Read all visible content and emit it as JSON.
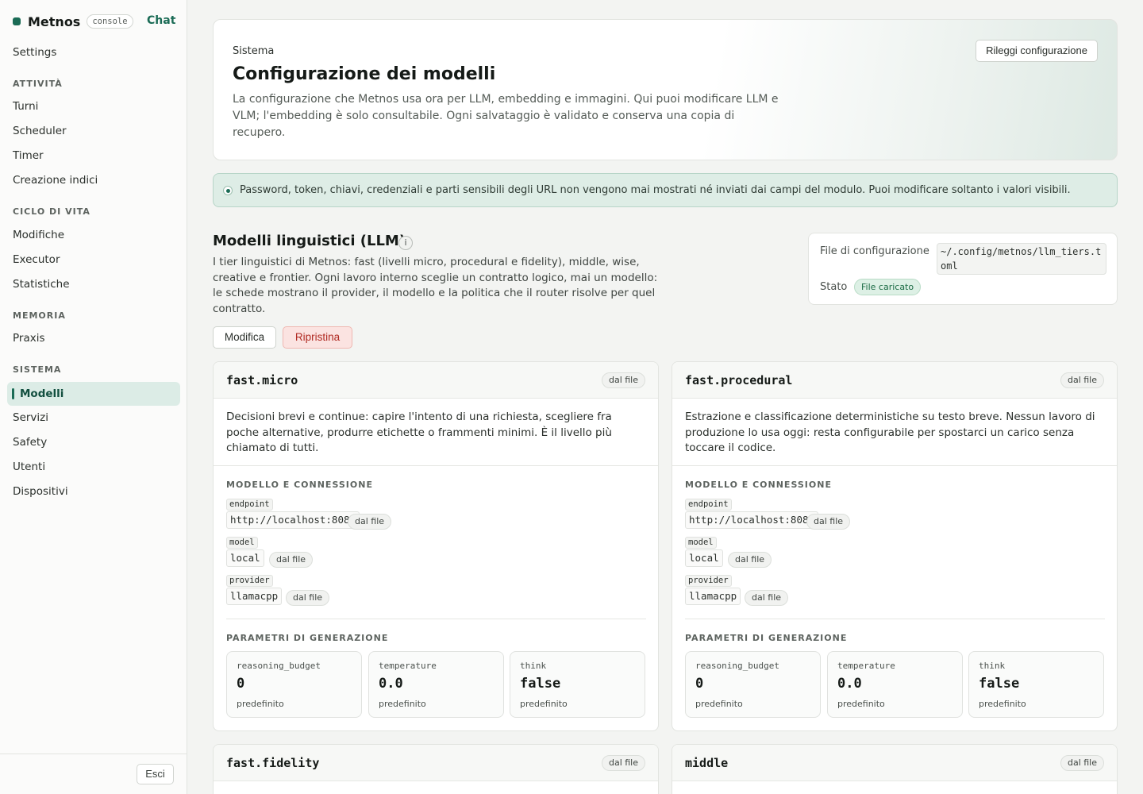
{
  "sidebar": {
    "brand": "Metnos",
    "badge": "console",
    "chat": "Chat",
    "settings": "Settings",
    "sections": [
      {
        "title": "ATTIVITÀ",
        "items": [
          "Turni",
          "Scheduler",
          "Timer",
          "Creazione indici"
        ]
      },
      {
        "title": "CICLO DI VITA",
        "items": [
          "Modifiche",
          "Executor",
          "Statistiche"
        ]
      },
      {
        "title": "MEMORIA",
        "items": [
          "Praxis"
        ]
      },
      {
        "title": "SISTEMA",
        "items": [
          "Modelli",
          "Servizi",
          "Safety",
          "Utenti",
          "Dispositivi"
        ]
      }
    ],
    "active": "Modelli",
    "logout": "Esci"
  },
  "header": {
    "kicker": "Sistema",
    "title": "Configurazione dei modelli",
    "description": "La configurazione che Metnos usa ora per LLM, embedding e immagini. Qui puoi modificare LLM e VLM; l'embedding è solo consultabile. Ogni salvataggio è validato e conserva una copia di recupero.",
    "reload_button": "Rileggi configurazione"
  },
  "notice": "Password, token, chiavi, credenziali e parti sensibili degli URL non vengono mai mostrati né inviati dai campi del modulo. Puoi modificare soltanto i valori visibili.",
  "llm": {
    "title": "Modelli linguistici (LLM)",
    "info": "i",
    "description": "I tier linguistici di Metnos: fast (livelli micro, procedural e fidelity), middle, wise, creative e frontier. Ogni lavoro interno sceglie un contratto logico, mai un modello: le schede mostrano il provider, il modello e la politica che il router risolve per quel contratto.",
    "edit_button": "Modifica",
    "reset_button": "Ripristina",
    "config": {
      "file_label": "File di configurazione",
      "file_path": "~/.config/metnos/llm_tiers.toml",
      "state_label": "Stato",
      "state_value": "File caricato"
    }
  },
  "labels": {
    "model_section": "MODELLO E CONNESSIONE",
    "params_section": "PARAMETRI DI GENERAZIONE"
  },
  "cards": [
    {
      "name": "fast.micro",
      "source": "dal file",
      "description": "Decisioni brevi e continue: capire l'intento di una richiesta, scegliere fra poche alternative, produrre etichette o frammenti minimi. È il livello più chiamato di tutti.",
      "fields": [
        {
          "label": "endpoint",
          "value": "http://localhost:8080",
          "source": "dal file"
        },
        {
          "label": "model",
          "value": "local",
          "source": "dal file"
        },
        {
          "label": "provider",
          "value": "llamacpp",
          "source": "dal file"
        }
      ],
      "params": [
        {
          "name": "reasoning_budget",
          "value": "0",
          "note": "predefinito"
        },
        {
          "name": "temperature",
          "value": "0.0",
          "note": "predefinito"
        },
        {
          "name": "think",
          "value": "false",
          "note": "predefinito"
        }
      ]
    },
    {
      "name": "fast.procedural",
      "source": "dal file",
      "description": "Estrazione e classificazione deterministiche su testo breve. Nessun lavoro di produzione lo usa oggi: resta configurabile per spostarci un carico senza toccare il codice.",
      "fields": [
        {
          "label": "endpoint",
          "value": "http://localhost:8080",
          "source": "dal file"
        },
        {
          "label": "model",
          "value": "local",
          "source": "dal file"
        },
        {
          "label": "provider",
          "value": "llamacpp",
          "source": "dal file"
        }
      ],
      "params": [
        {
          "name": "reasoning_budget",
          "value": "0",
          "note": "predefinito"
        },
        {
          "name": "temperature",
          "value": "0.0",
          "note": "predefinito"
        },
        {
          "name": "think",
          "value": "false",
          "note": "predefinito"
        }
      ]
    },
    {
      "name": "fast.fidelity",
      "source": "dal file"
    },
    {
      "name": "middle",
      "source": "dal file"
    }
  ]
}
